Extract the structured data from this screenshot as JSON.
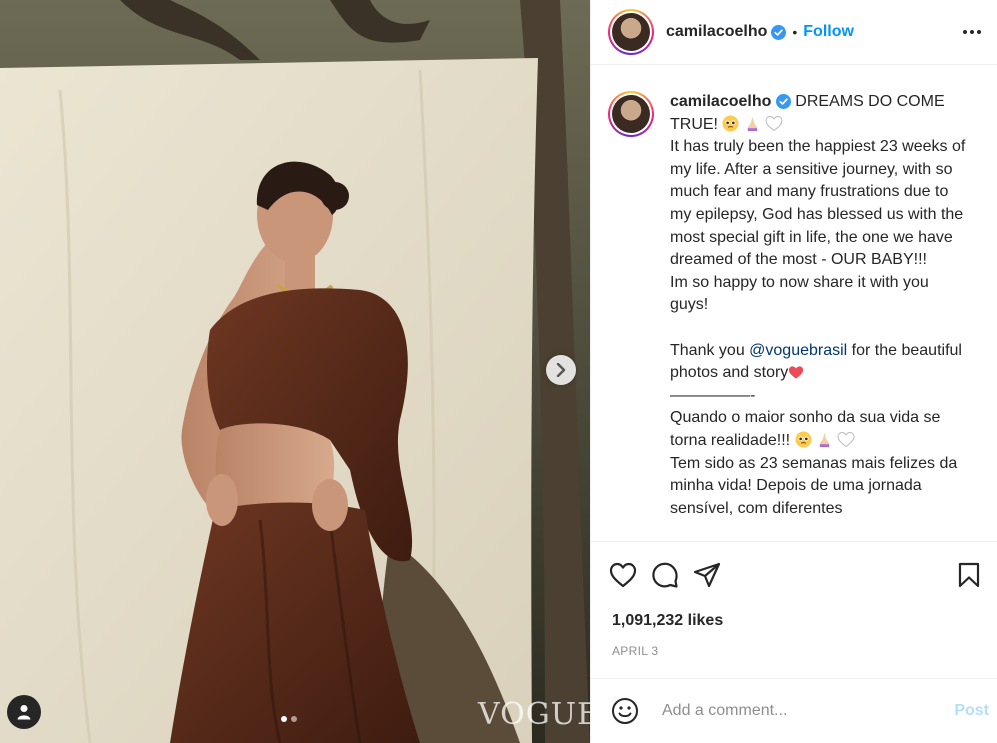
{
  "post": {
    "username": "camilacoelho",
    "follow_label": "Follow",
    "separator": "•",
    "watermark": "VOGUE",
    "caption": {
      "line_title": "DREAMS DO COME TRUE!",
      "p1": "It has truly been the happiest 23 weeks of my life. After a sensitive journey, with so much fear and many frustrations due to my epilepsy, God has blessed us with the most special gift in life, the one we have dreamed of the most - OUR BABY!!!",
      "p2": "Im so happy to now share it with you guys!",
      "p3_before": "Thank you ",
      "p3_mention": "@voguebrasil",
      "p3_after": " for the beautiful photos and story",
      "divider": "—————-",
      "pt1": "Quando o maior sonho da sua vida se torna realidade!!!",
      "pt2": "Tem sido as 23 semanas mais felizes da minha vida! Depois de uma jornada sensível, com diferentes"
    },
    "likes": "1,091,232 likes",
    "date": "APRIL 3",
    "comment_placeholder": "Add a comment...",
    "post_label": "Post",
    "carousel": {
      "total": 2,
      "active": 1
    }
  },
  "colors": {
    "follow": "#0095f6",
    "post_disabled": "#b2dffc",
    "mention": "#00376b",
    "heart_emoji": "#ed4956",
    "verified": "#3897f0",
    "muted": "#8e8e8e"
  },
  "icons": [
    "heart-icon",
    "comment-icon",
    "share-icon",
    "bookmark-icon",
    "smiley-icon",
    "chevron-right-icon",
    "user-tag-icon",
    "verified-badge-icon",
    "more-options-icon"
  ]
}
